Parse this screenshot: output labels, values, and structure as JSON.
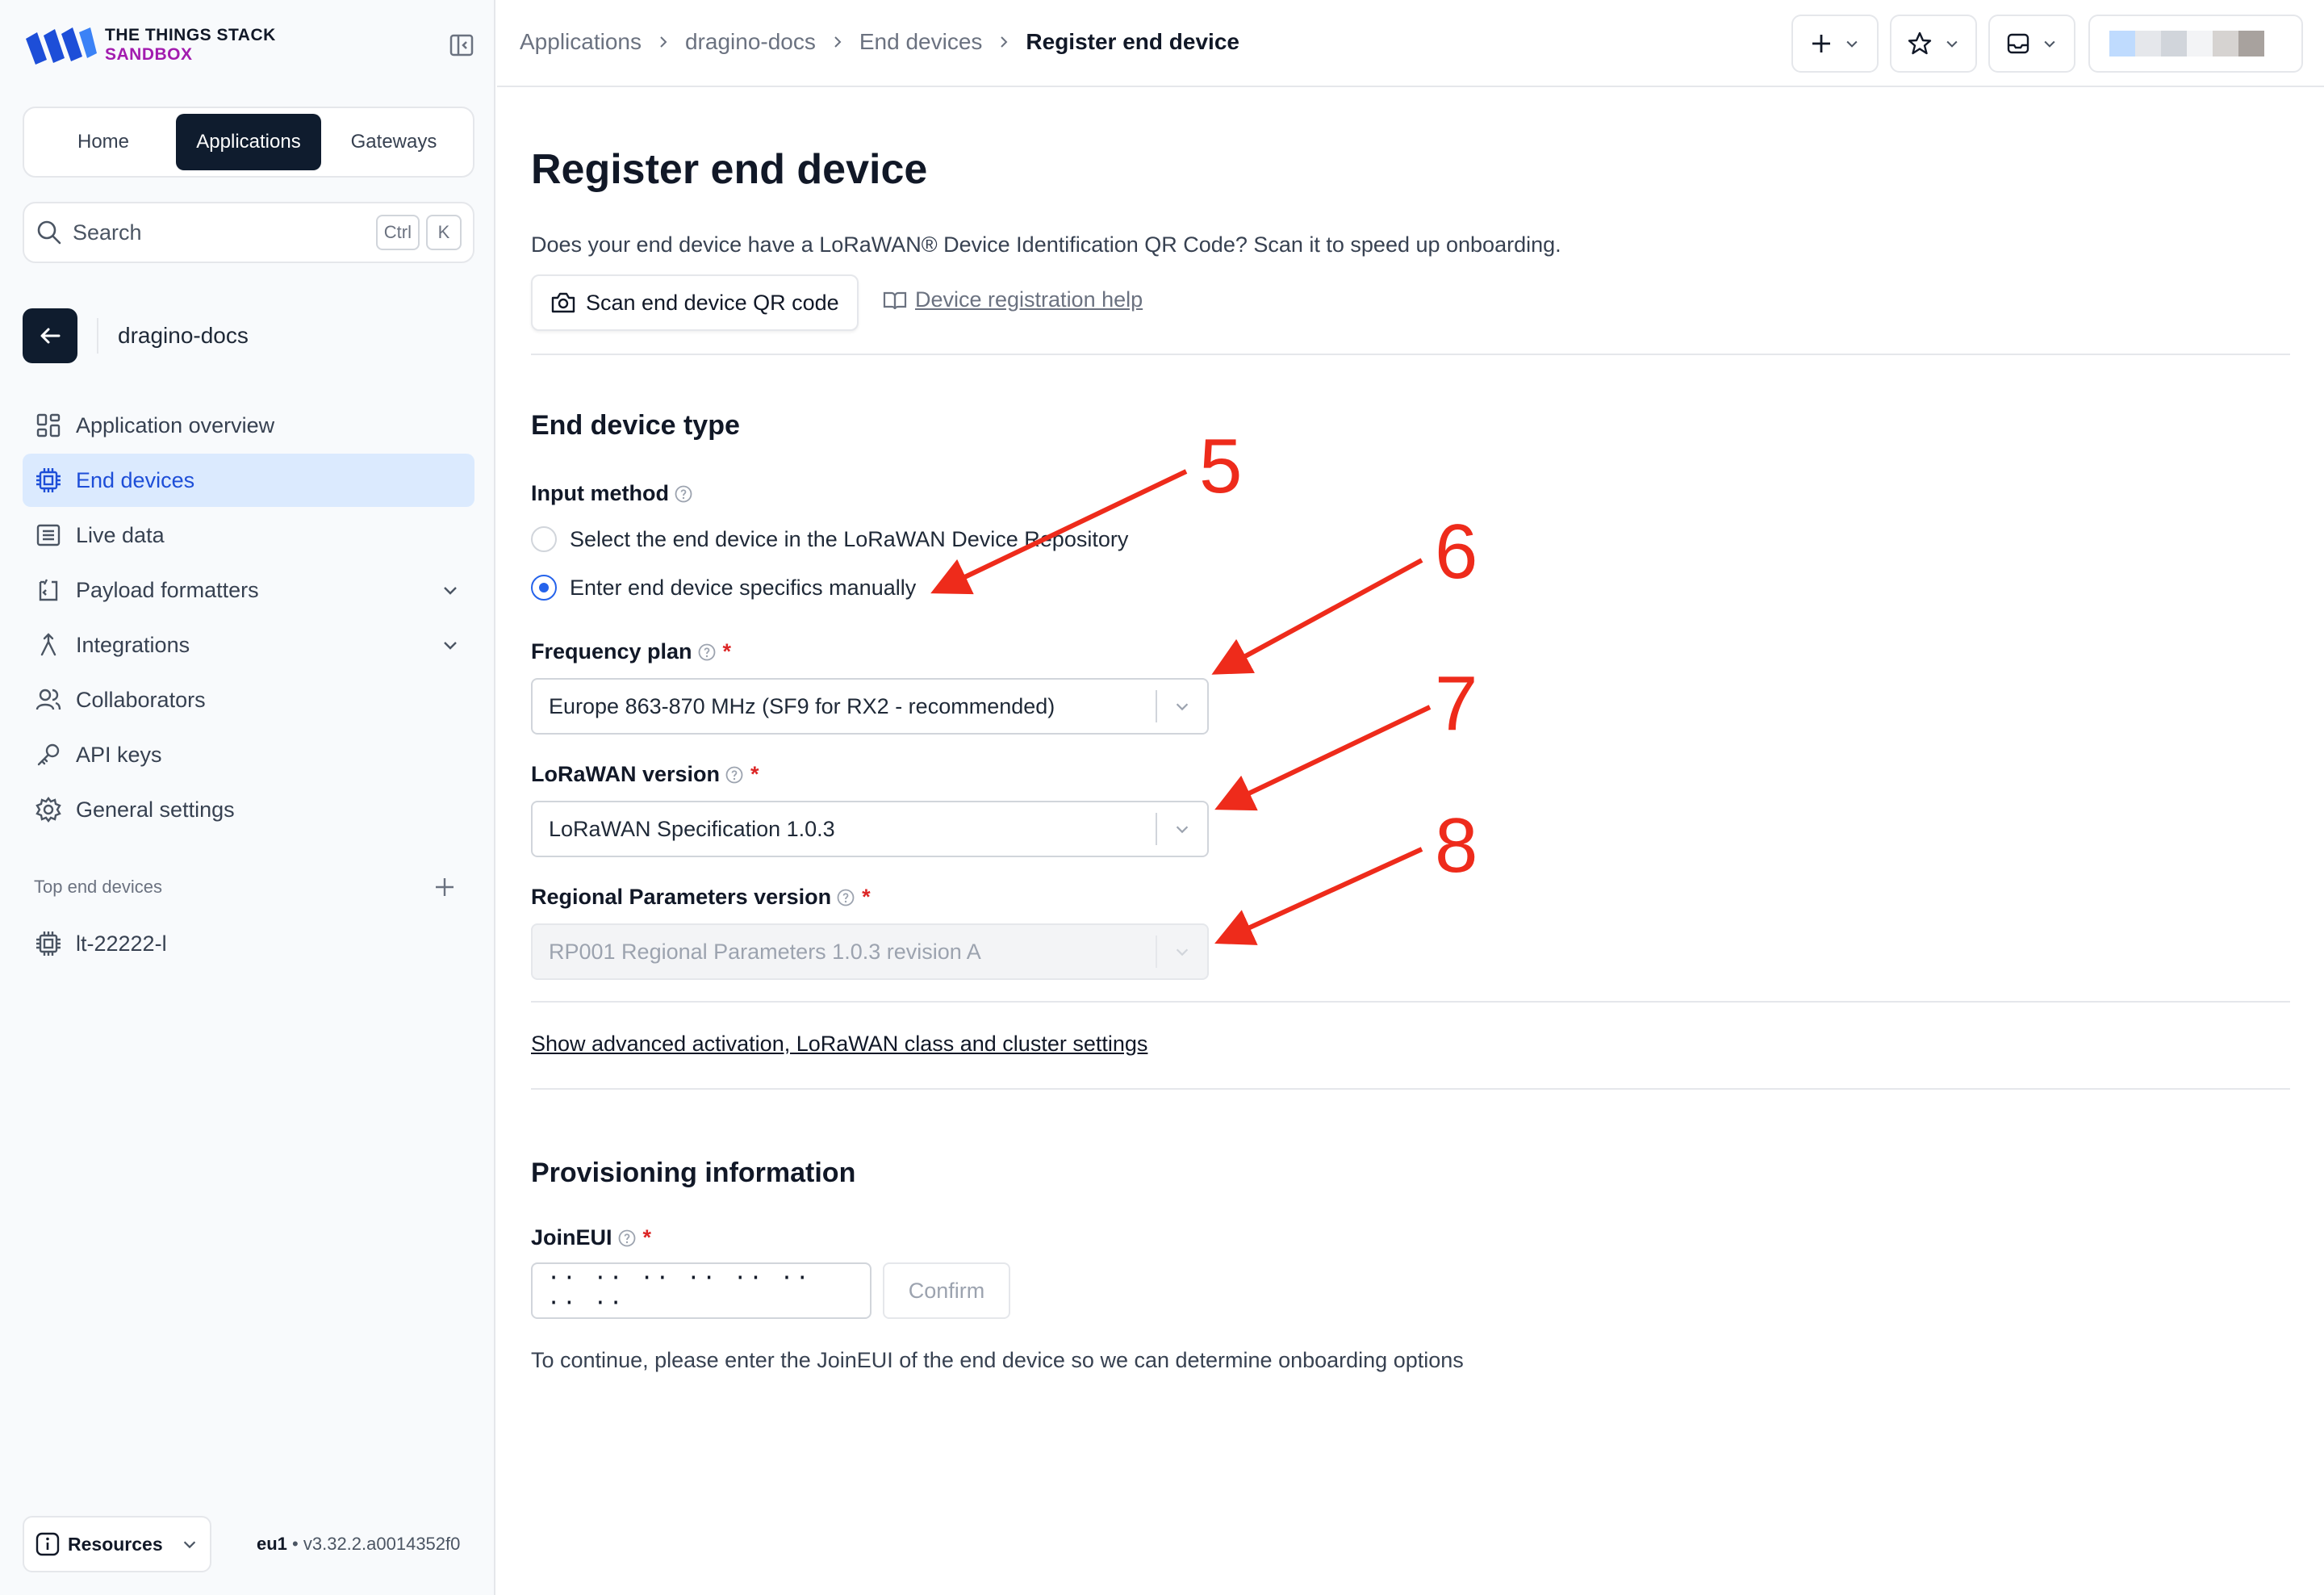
{
  "brand": {
    "line1": "THE THINGS STACK",
    "line2": "SANDBOX"
  },
  "nav_tabs": [
    {
      "label": "Home"
    },
    {
      "label": "Applications",
      "active": true
    },
    {
      "label": "Gateways"
    }
  ],
  "search": {
    "placeholder": "Search",
    "kbd1": "Ctrl",
    "kbd2": "K"
  },
  "app": {
    "name": "dragino-docs"
  },
  "sidebar": {
    "items": [
      {
        "label": "Application overview",
        "icon": "grid-icon"
      },
      {
        "label": "End devices",
        "icon": "chip-icon",
        "active": true
      },
      {
        "label": "Live data",
        "icon": "list-icon"
      },
      {
        "label": "Payload formatters",
        "icon": "code-icon",
        "expandable": true
      },
      {
        "label": "Integrations",
        "icon": "merge-icon",
        "expandable": true
      },
      {
        "label": "Collaborators",
        "icon": "users-icon"
      },
      {
        "label": "API keys",
        "icon": "key-icon"
      },
      {
        "label": "General settings",
        "icon": "gear-icon"
      }
    ],
    "top_devices_label": "Top end devices",
    "top_devices": [
      {
        "label": "lt-22222-l"
      }
    ],
    "resources_label": "Resources",
    "cluster": "eu1",
    "version": "v3.32.2.a0014352f0"
  },
  "breadcrumb": [
    "Applications",
    "dragino-docs",
    "End devices",
    "Register end device"
  ],
  "page": {
    "title": "Register end device",
    "intro": "Does your end device have a LoRaWAN® Device Identification QR Code? Scan it to speed up onboarding.",
    "scan_button": "Scan end device QR code",
    "help_link": "Device registration help",
    "section_type": "End device type",
    "input_method_label": "Input method",
    "input_methods": [
      {
        "label": "Select the end device in the LoRaWAN Device Repository",
        "selected": false
      },
      {
        "label": "Enter end device specifics manually",
        "selected": true
      }
    ],
    "frequency_plan": {
      "label": "Frequency plan",
      "value": "Europe 863-870 MHz (SF9 for RX2 - recommended)"
    },
    "lorawan_version": {
      "label": "LoRaWAN version",
      "value": "LoRaWAN Specification 1.0.3"
    },
    "regional_params": {
      "label": "Regional Parameters version",
      "value": "RP001 Regional Parameters 1.0.3 revision A",
      "disabled": true
    },
    "advanced_link": "Show advanced activation, LoRaWAN class and cluster settings",
    "section_provisioning": "Provisioning information",
    "joineui": {
      "label": "JoinEUI",
      "value": "·· ·· ·· ·· ·· ·· ·· ··",
      "confirm": "Confirm"
    },
    "hint": "To continue, please enter the JoinEUI of the end device so we can determine onboarding options"
  },
  "annotations": [
    {
      "number": "5"
    },
    {
      "number": "6"
    },
    {
      "number": "7"
    },
    {
      "number": "8"
    }
  ],
  "colors": {
    "accent": "#2563eb",
    "dark": "#0f1c2e",
    "annotation": "#ee2b1b",
    "required": "#dc2626"
  }
}
